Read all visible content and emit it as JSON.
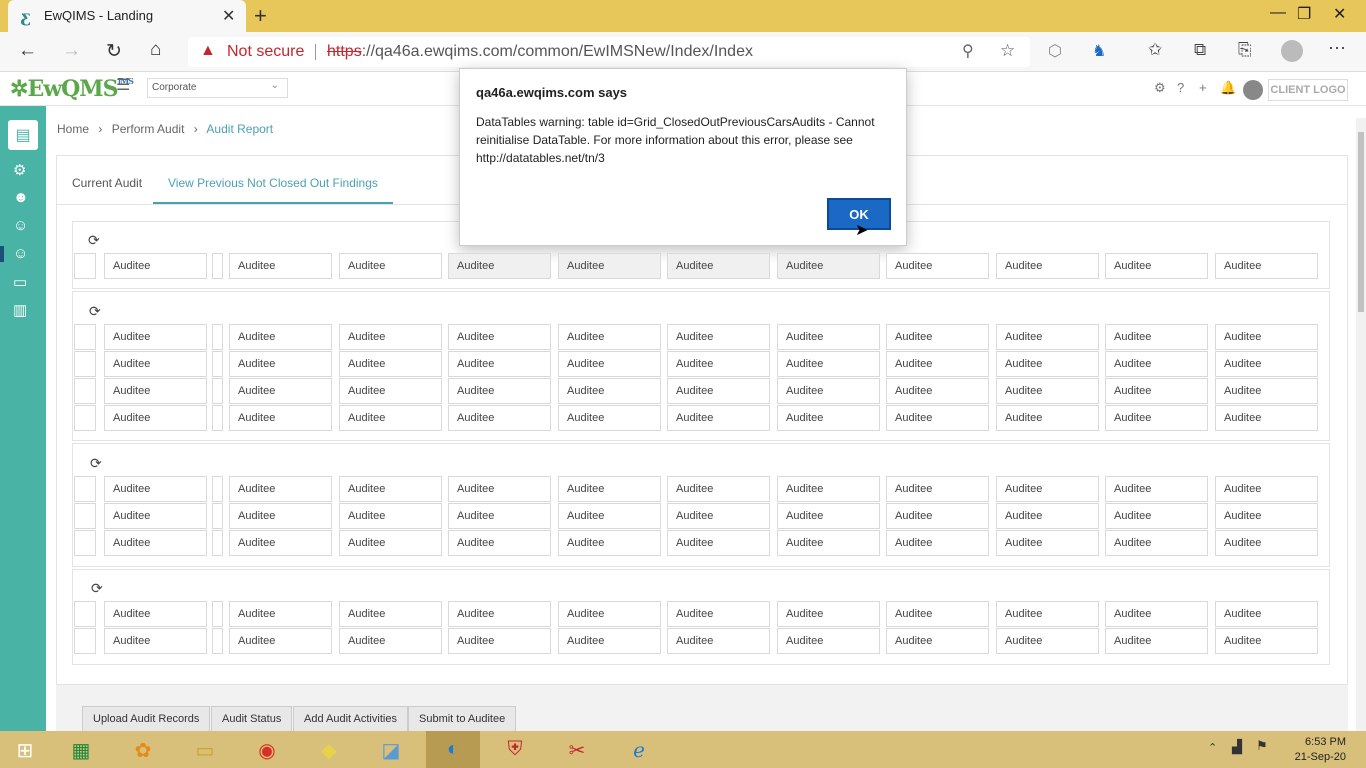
{
  "browser": {
    "tab_title": "EwQIMS - Landing",
    "tab_close": "✕",
    "new_tab": "+",
    "window_controls": {
      "minimize": "—",
      "restore": "❐",
      "close": "✕"
    },
    "not_secure": "Not secure",
    "url_scheme": "https",
    "url_rest": "://qa46a.ewqims.com/common/EwIMSNew/Index/Index"
  },
  "app": {
    "logo_text": "EwQMS",
    "logo_small": "IMS",
    "org_select": "Corporate",
    "client_logo": "CLIENT LOGO"
  },
  "breadcrumb": {
    "home": "Home",
    "sep": "›",
    "perform": "Perform Audit",
    "current": "Audit Report"
  },
  "tabs": {
    "current": "Current Audit",
    "previous": "View Previous Not Closed Out Findings"
  },
  "cell_text": "Auditee",
  "grids_rows": [
    1,
    4,
    3,
    2
  ],
  "bottom_buttons": [
    "Upload Audit Records",
    "Audit Status",
    "Add Audit Activities",
    "Submit to Auditee"
  ],
  "dialog": {
    "title": "qa46a.ewqims.com says",
    "message": "DataTables warning: table id=Grid_ClosedOutPreviousCarsAudits - Cannot reinitialise DataTable. For more information about this error, please see http://datatables.net/tn/3",
    "ok": "OK"
  },
  "taskbar": {
    "time": "6:53 PM",
    "date": "21-Sep-20"
  },
  "colors": {
    "accent": "#49b3a6",
    "link": "#4aa1b5",
    "ok_button": "#1a69c4",
    "titlebar": "#e8c75a",
    "taskbar": "#d9c07a"
  }
}
